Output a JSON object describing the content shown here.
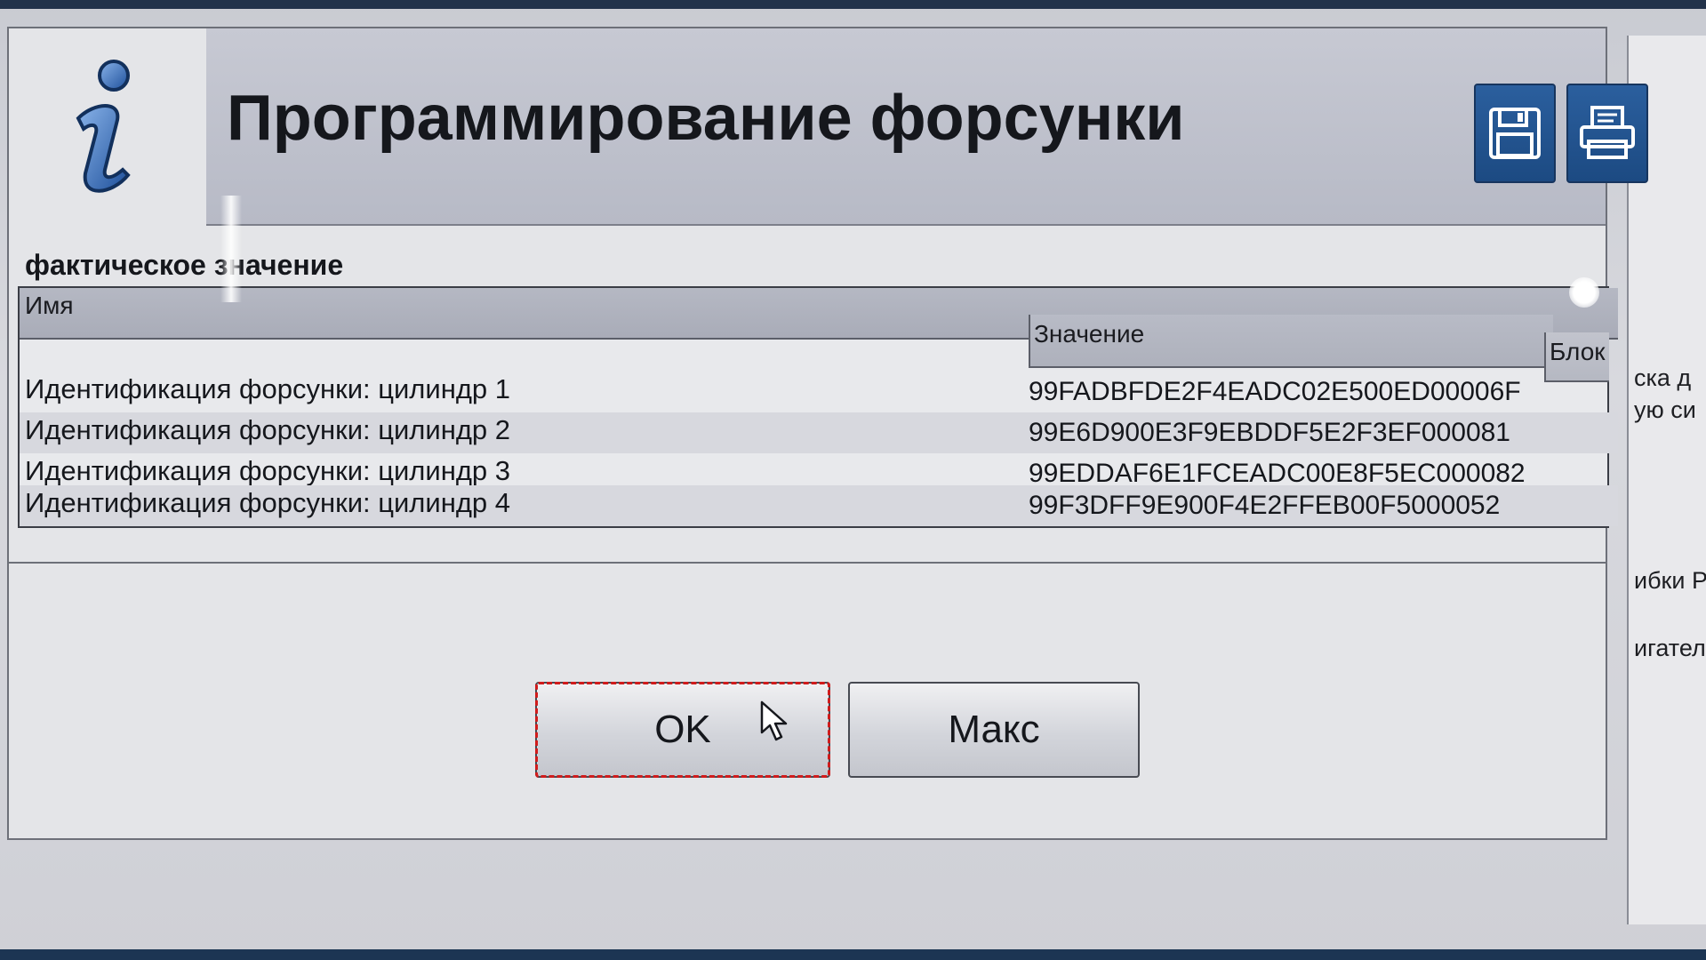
{
  "dialog": {
    "title": "Программирование форсунки",
    "icon": "info-icon",
    "header_buttons": [
      {
        "icon": "save-icon"
      },
      {
        "icon": "print-icon"
      }
    ],
    "section_label": "фактическое значение",
    "table": {
      "columns": [
        "Имя",
        "Значение",
        "Блок"
      ],
      "rows": [
        {
          "name": "Идентификация форсунки: цилиндр 1",
          "value": "99FADBFDE2F4EADC02E500ED00006F",
          "block": ""
        },
        {
          "name": "Идентификация форсунки: цилиндр 2",
          "value": "99E6D900E3F9EBDDF5E2F3EF000081",
          "block": ""
        },
        {
          "name": "Идентификация форсунки: цилиндр 3",
          "value": "99EDDAF6E1FCEADC00E8F5EC000082",
          "block": ""
        },
        {
          "name": "Идентификация форсунки: цилиндр 4",
          "value": "99F3DFF9E900F4E2FFEB00F5000052",
          "block": ""
        }
      ]
    },
    "buttons": {
      "ok_label": "OK",
      "max_label": "Макс"
    }
  },
  "background": {
    "fragments": [
      "ска д",
      "ую си",
      "ибки Р",
      "игател"
    ]
  },
  "colors": {
    "header_button_bg": "#1c4a82",
    "focus_outline": "#d11c1c"
  }
}
